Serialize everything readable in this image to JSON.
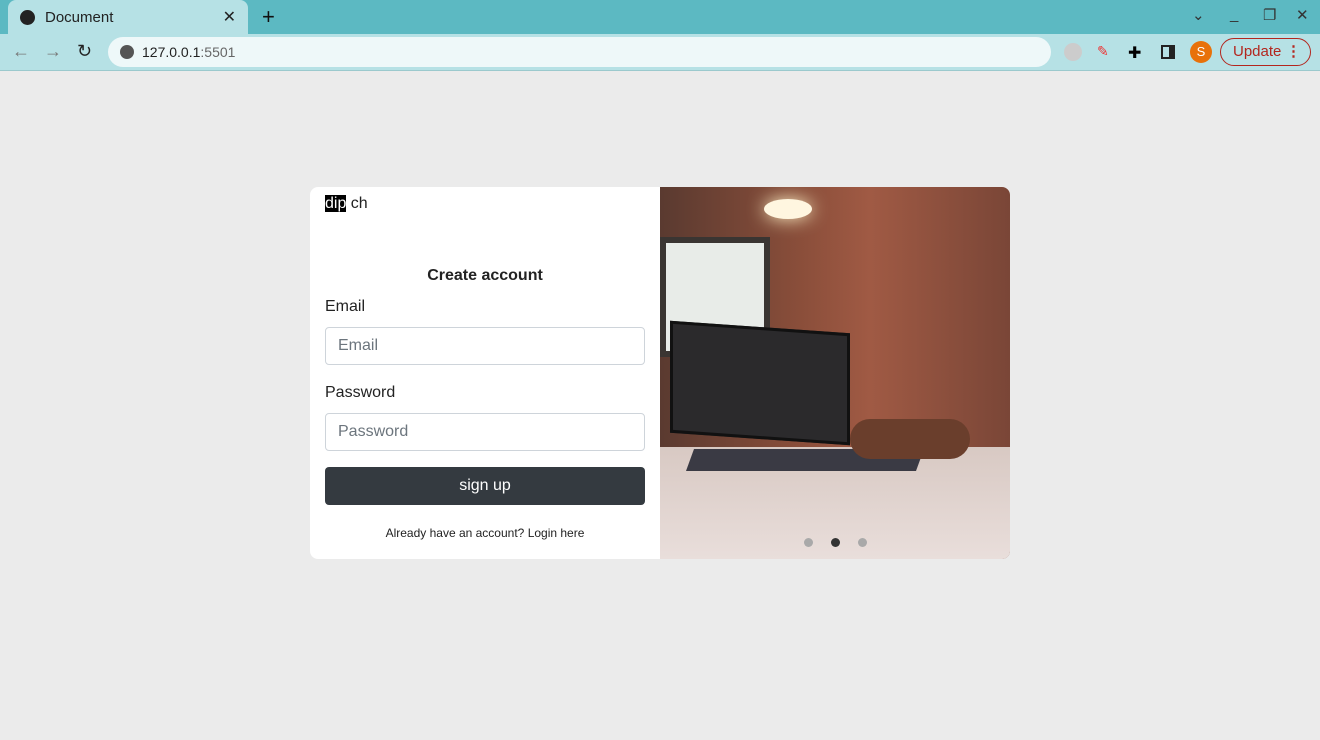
{
  "browser": {
    "tab_title": "Document",
    "url_host": "127.0.0.1",
    "url_port": ":5501",
    "profile_initial": "S",
    "update_label": "Update"
  },
  "logo": {
    "highlight": "dip",
    "rest": " ch"
  },
  "form": {
    "title": "Create account",
    "email_label": "Email",
    "email_placeholder": "Email",
    "password_label": "Password",
    "password_placeholder": "Password",
    "submit_label": "sign up",
    "footer_text": "Already have an account?",
    "login_link": "Login here"
  },
  "carousel": {
    "slide_count": 3,
    "active_index": 1
  }
}
